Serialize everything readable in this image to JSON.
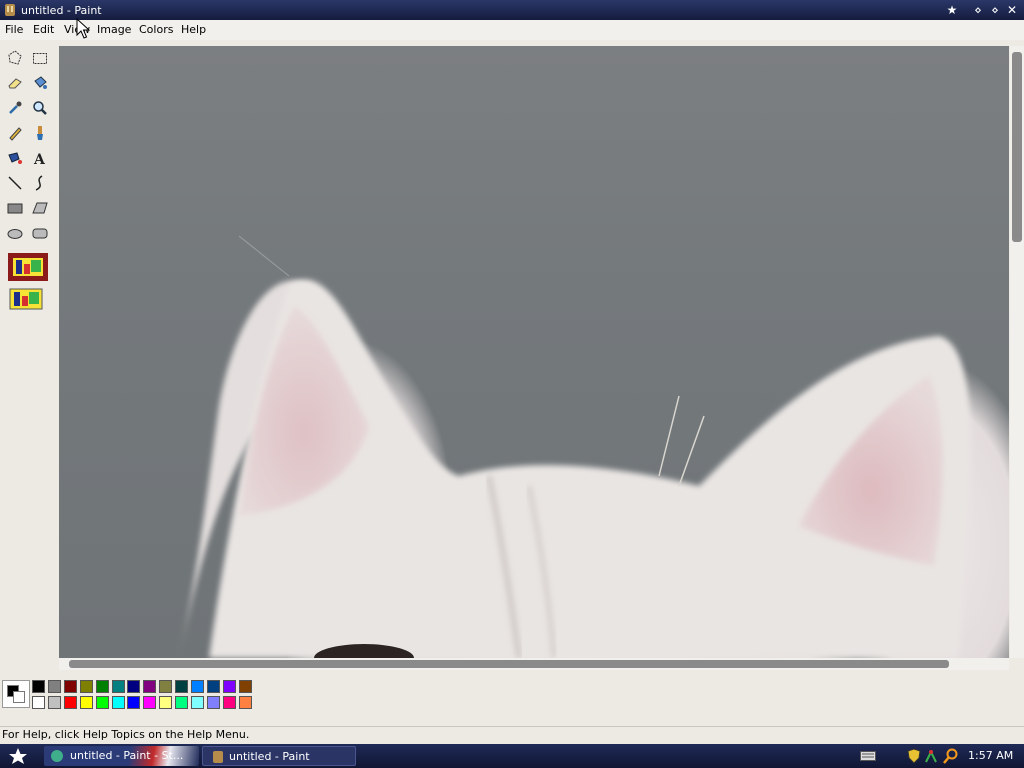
{
  "window": {
    "title": "untitled - Paint",
    "app_icon": "paint-app-icon",
    "controls": [
      {
        "name": "special-star-icon",
        "glyph": "★"
      },
      {
        "name": "minimize-icon",
        "glyph": "⋄"
      },
      {
        "name": "maximize-icon",
        "glyph": "⋄"
      },
      {
        "name": "close-icon",
        "glyph": "✕"
      }
    ]
  },
  "menu": {
    "file": "File",
    "edit": "Edit",
    "view": "View",
    "image": "Image",
    "colors": "Colors",
    "help": "Help"
  },
  "toolbox": {
    "tools": [
      "free-form-select-icon",
      "rectangle-select-icon",
      "eraser-icon",
      "fill-bucket-icon",
      "color-picker-icon",
      "magnifier-icon",
      "pencil-icon",
      "brush-icon",
      "airbrush-icon",
      "text-icon",
      "line-icon",
      "curve-icon",
      "rectangle-icon",
      "polygon-icon",
      "ellipse-icon",
      "rounded-rectangle-icon"
    ],
    "extras": [
      "color-box-tool-icon",
      "color-box-tool-alt-icon"
    ]
  },
  "palette": {
    "foreground": "#000000",
    "background": "#ffffff",
    "top_row": [
      "#000000",
      "#808080",
      "#800000",
      "#808000",
      "#008000",
      "#008080",
      "#000080",
      "#800080",
      "#808040",
      "#004040",
      "#0080ff",
      "#004080",
      "#8000ff",
      "#804000"
    ],
    "bottom_row": [
      "#ffffff",
      "#c0c0c0",
      "#ff0000",
      "#ffff00",
      "#00ff00",
      "#00ffff",
      "#0000ff",
      "#ff00ff",
      "#ffff80",
      "#00ff80",
      "#80ffff",
      "#8080ff",
      "#ff0080",
      "#ff8040"
    ]
  },
  "status": {
    "help_text": "For Help, click Help Topics on the Help Menu."
  },
  "taskbar": {
    "tasks": [
      {
        "label": "untitled - Paint - St..."
      },
      {
        "label": "untitled - Paint"
      }
    ],
    "clock": "1:57 AM",
    "tray_icons": [
      "keyboard-icon",
      "shield-icon",
      "network-icon",
      "search-icon"
    ]
  }
}
